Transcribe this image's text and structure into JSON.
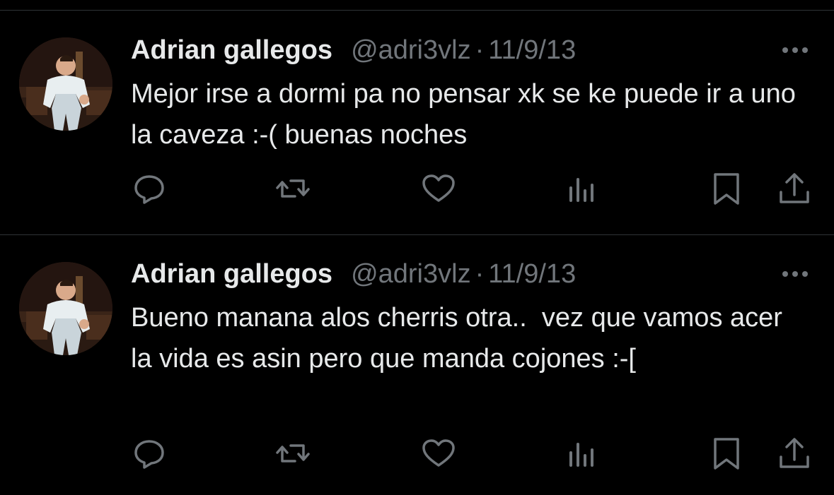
{
  "tweets": [
    {
      "author_name": "Adrian gallegos",
      "handle": "@adri3vlz",
      "separator": "·",
      "date": "11/9/13",
      "text": "Mejor irse a dormi pa no pensar xk se ke puede ir a uno la caveza :-( buenas noches"
    },
    {
      "author_name": "Adrian gallegos",
      "handle": "@adri3vlz",
      "separator": "·",
      "date": "11/9/13",
      "text": "Bueno manana alos cherris otra..  vez que vamos acer la vida es asin pero que manda cojones :-["
    }
  ],
  "icons": {
    "reply": "reply-icon",
    "retweet": "retweet-icon",
    "like": "like-icon",
    "views": "views-icon",
    "bookmark": "bookmark-icon",
    "share": "share-icon",
    "more": "more-icon"
  },
  "colors": {
    "background": "#000000",
    "primary_text": "#e7e9ea",
    "secondary_text": "#71767b",
    "divider": "#2f3336"
  }
}
